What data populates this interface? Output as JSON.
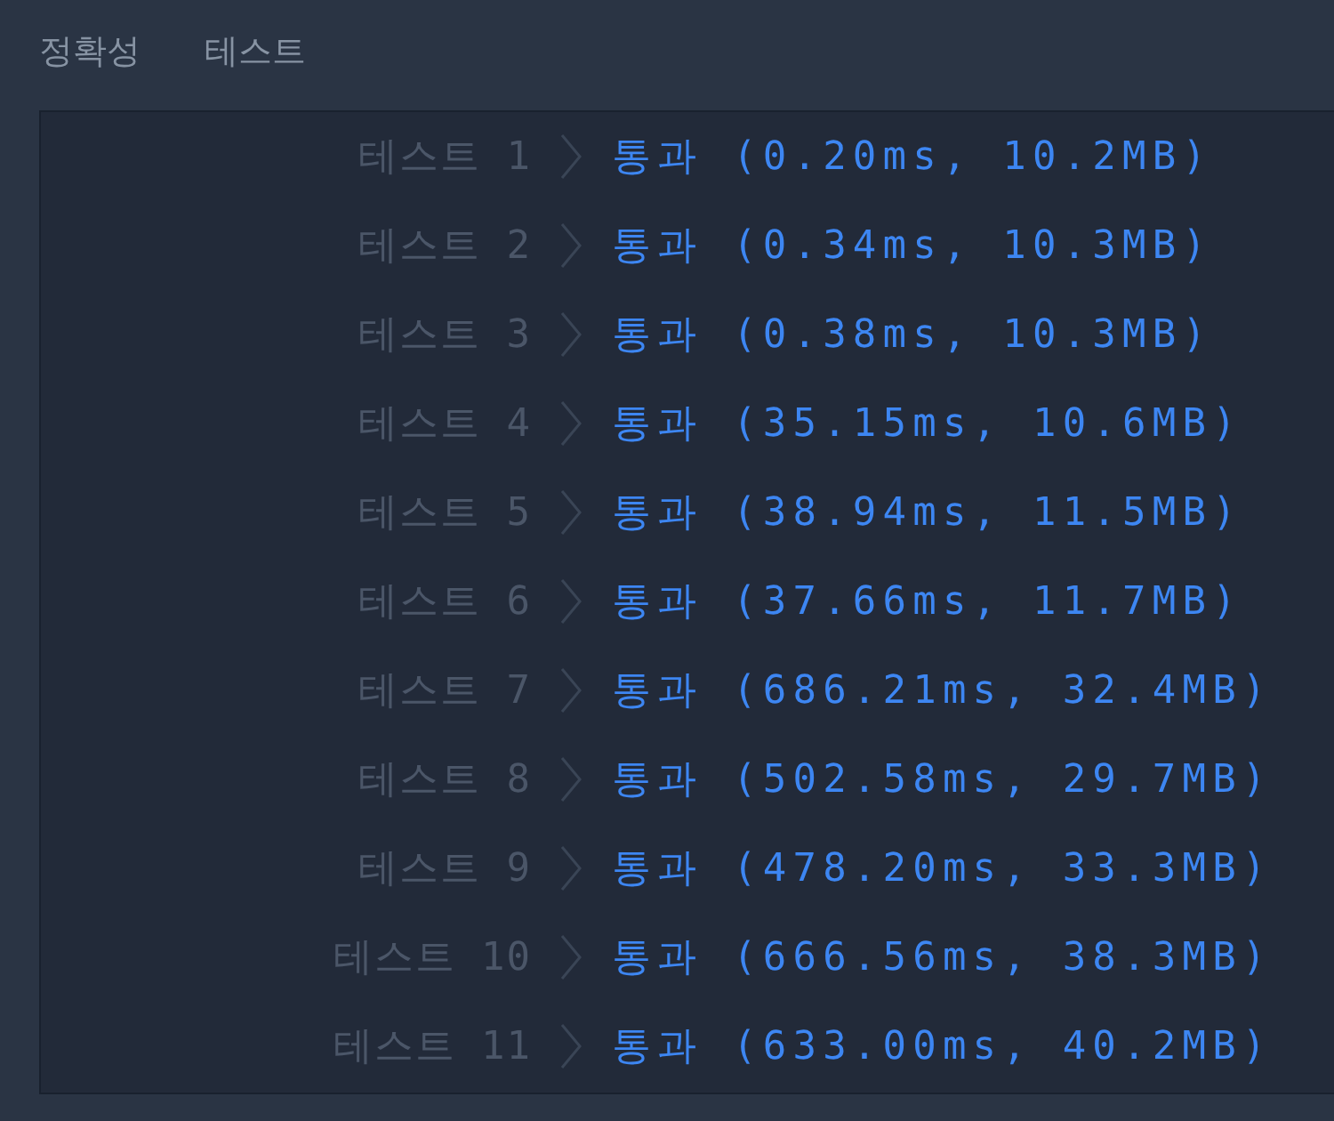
{
  "section": {
    "title": "정확성  테스트"
  },
  "tests": [
    {
      "label": "테스트 1",
      "result": "통과 (0.20ms, 10.2MB)"
    },
    {
      "label": "테스트 2",
      "result": "통과 (0.34ms, 10.3MB)"
    },
    {
      "label": "테스트 3",
      "result": "통과 (0.38ms, 10.3MB)"
    },
    {
      "label": "테스트 4",
      "result": "통과 (35.15ms, 10.6MB)"
    },
    {
      "label": "테스트 5",
      "result": "통과 (38.94ms, 11.5MB)"
    },
    {
      "label": "테스트 6",
      "result": "통과 (37.66ms, 11.7MB)"
    },
    {
      "label": "테스트 7",
      "result": "통과 (686.21ms, 32.4MB)"
    },
    {
      "label": "테스트 8",
      "result": "통과 (502.58ms, 29.7MB)"
    },
    {
      "label": "테스트 9",
      "result": "통과 (478.20ms, 33.3MB)"
    },
    {
      "label": "테스트 10",
      "result": "통과 (666.56ms, 38.3MB)"
    },
    {
      "label": "테스트 11",
      "result": "통과 (633.00ms, 40.2MB)"
    }
  ]
}
